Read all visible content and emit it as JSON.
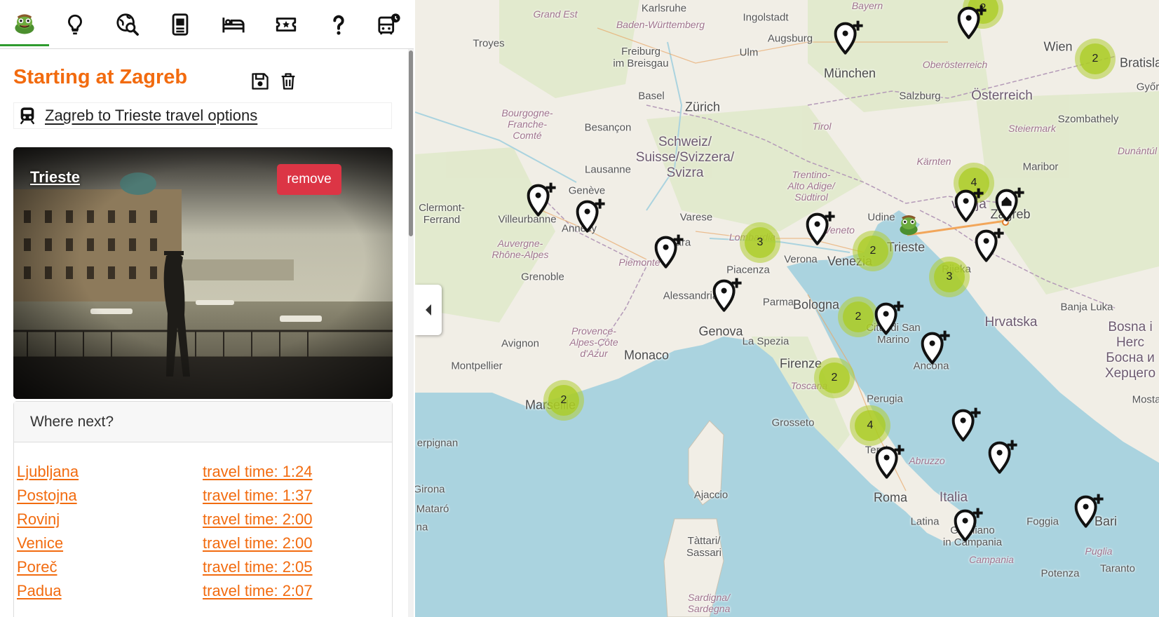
{
  "nav": {
    "items": [
      {
        "name": "home-logo-icon"
      },
      {
        "name": "ideas-lightbulb-icon"
      },
      {
        "name": "search-globe-icon"
      },
      {
        "name": "guide-book-icon"
      },
      {
        "name": "hotel-bed-icon"
      },
      {
        "name": "tickets-icon"
      },
      {
        "name": "help-icon"
      },
      {
        "name": "bus-schedule-icon"
      }
    ]
  },
  "trip": {
    "title": "Starting at Zagreb",
    "travel_options_link": "Zagreb to Trieste travel options"
  },
  "destination": {
    "name": "Trieste",
    "remove_label": "remove"
  },
  "where_next": {
    "header": "Where next?",
    "rows": [
      {
        "city": "Ljubljana",
        "time": "travel time: 1:24"
      },
      {
        "city": "Postojna",
        "time": "travel time: 1:37"
      },
      {
        "city": "Rovinj",
        "time": "travel time: 2:00"
      },
      {
        "city": "Venice",
        "time": "travel time: 2:00"
      },
      {
        "city": "Poreč",
        "time": "travel time: 2:05"
      },
      {
        "city": "Padua",
        "time": "travel time: 2:07"
      }
    ]
  },
  "map": {
    "labels": {
      "grand_est": "Grand Est",
      "karlsruhe": "Karlsruhe",
      "baden": "Baden-Württemberg",
      "ingolstadt": "Ingolstadt",
      "bayern": "Bayern",
      "troyes": "Troyes",
      "augsburg": "Augsburg",
      "ulm": "Ulm",
      "freiburg": "Freiburg\nim Breisgau",
      "munchen": "München",
      "oberosterreich": "Oberösterreich",
      "wien": "Wien",
      "bratislava": "Bratisla",
      "basel": "Basel",
      "salzburg": "Salzburg",
      "osterreich": "Österreich",
      "gyor": "Győr",
      "zurich": "Zürich",
      "bourgogne": "Bourgogne-\nFranche-\nComté",
      "besancon": "Besançon",
      "schweiz": "Schweiz/\nSuisse/Svizzera/\nSvizra",
      "tirol": "Tirol",
      "steiermark": "Steiermark",
      "szombathely": "Szombathely",
      "dunantul": "Dunántúl",
      "lausanne": "Lausanne",
      "karnten": "Kärnten",
      "maribor": "Maribor",
      "geneve": "Genève",
      "trentino": "Trentino-\nAlto Adige/\nSüdtirol",
      "clermont": "Clermont-\nFerrand",
      "villeurbanne": "Villeurbanne",
      "annecy": "Annecy",
      "slovenija": "venija",
      "zagreb": "Zagreb",
      "varese": "Varese",
      "udine": "Udine",
      "veneto": "Veneto",
      "novara": "Novara",
      "lombardia": "Lombardia",
      "trieste": "Trieste",
      "auvergne": "Auvergne-\nRhône-Alpes",
      "piemonte": "Piemonte",
      "verona": "Verona",
      "venezia": "Venezia",
      "rijeka": "Rijeka",
      "grenoble": "Grenoble",
      "piacenza": "Piacenza",
      "alessandria": "Alessandria",
      "parma": "Parma",
      "bologna": "Bologna",
      "banja_luka": "Banja Luka",
      "hrvatska": "Hrvatska",
      "genova": "Genova",
      "citta_san_marino": "Città di San\nMarino",
      "provence": "Provence-\nAlpes-Côte\nd'Azur",
      "bosna": "Bosna i Herc\nБосна и\nХерцего",
      "avignon": "Avignon",
      "monaco": "Monaco",
      "la_spezia": "La Spezia",
      "montpellier": "Montpellier",
      "firenze": "Firenze",
      "ancona": "Ancona",
      "toscana": "Toscana",
      "marseille": "Marseille",
      "mostar": "Mosta",
      "perugia": "Perugia",
      "grosseto": "Grosseto",
      "perpignan": "erpignan",
      "terni": "Terni",
      "abruzzo": "Abruzzo",
      "girona": "Girona",
      "ajaccio": "Ajaccio",
      "roma": "Roma",
      "italia": "Italia",
      "mataro": "Mataró",
      "na": "na",
      "latina": "Latina",
      "foggia": "Foggia",
      "bari": "Bari",
      "tattari": "Tàttari/\nSassari",
      "giugliano": "Giugliano\nin Campania",
      "puglia": "Puglia",
      "campania": "Campania",
      "taranto": "Taranto",
      "potenza": "Potenza",
      "sardigna": "Sardigna/\nSardegna"
    },
    "clusters": [
      {
        "count": "2"
      },
      {
        "count": "2"
      },
      {
        "count": "4"
      },
      {
        "count": "3"
      },
      {
        "count": "2"
      },
      {
        "count": "3"
      },
      {
        "count": "2"
      },
      {
        "count": "2"
      },
      {
        "count": "4"
      },
      {
        "count": "2"
      }
    ]
  }
}
